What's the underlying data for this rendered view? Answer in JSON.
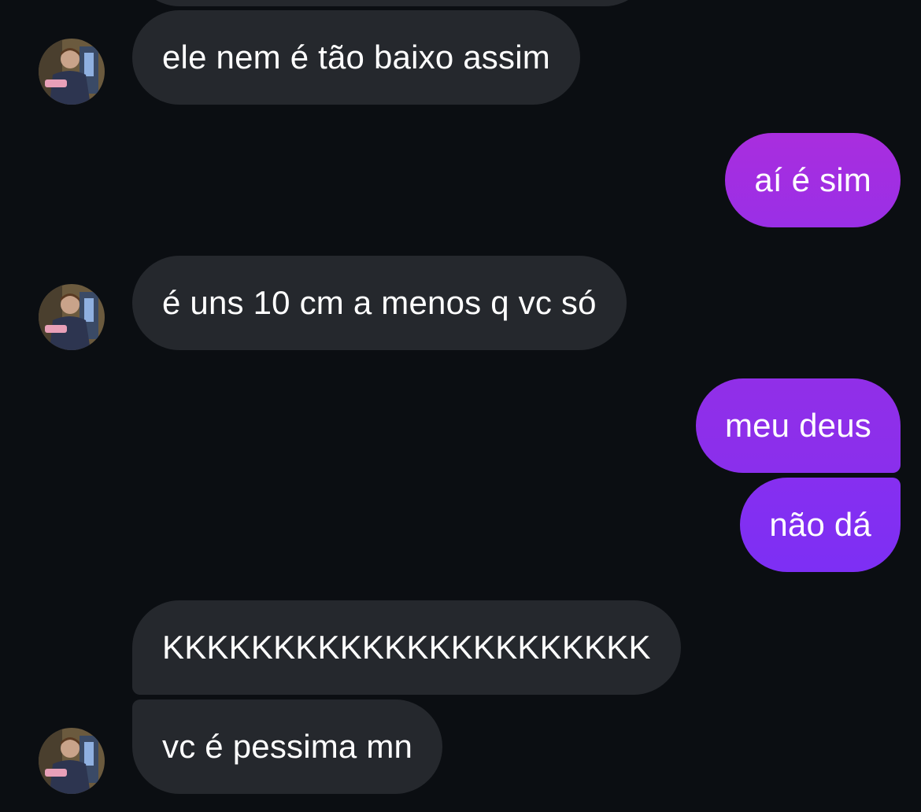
{
  "conversation": {
    "messages": [
      {
        "sender": "them",
        "text": "ele nem é tão baixo assim"
      },
      {
        "sender": "me",
        "text": "aí é sim"
      },
      {
        "sender": "them",
        "text": "é uns 10 cm a menos q vc só"
      },
      {
        "sender": "me",
        "text": "meu deus"
      },
      {
        "sender": "me",
        "text": "não dá"
      },
      {
        "sender": "them",
        "text": "KKKKKKKKKKKKKKKKKKKKKK"
      },
      {
        "sender": "them",
        "text": "vc é pessima mn"
      }
    ]
  },
  "colors": {
    "background": "#0b0e12",
    "incoming_bubble": "#25282d",
    "outgoing_gradient_top": "#a62ee0",
    "outgoing_gradient_bottom": "#7a2ff2",
    "text": "#ffffff"
  }
}
